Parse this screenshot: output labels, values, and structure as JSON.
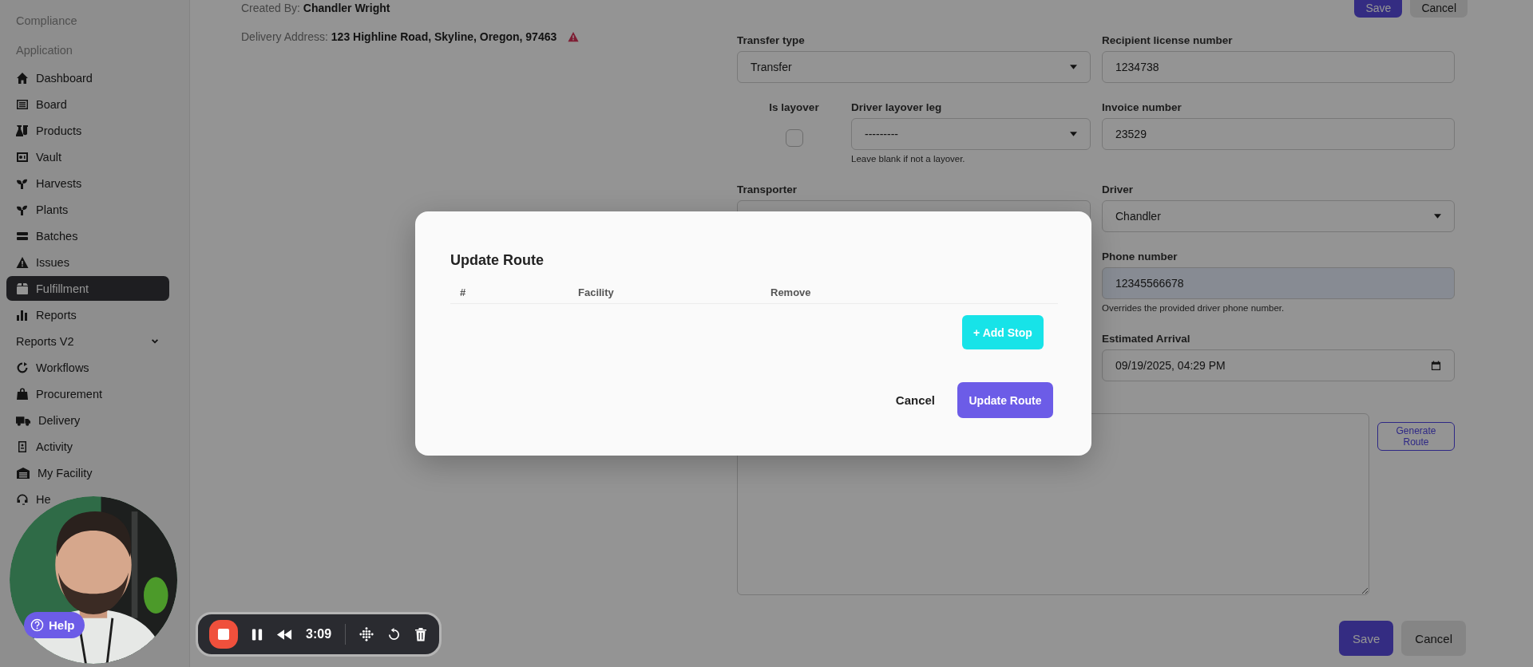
{
  "sidebar": {
    "sections": [
      "Compliance",
      "Application"
    ],
    "items": [
      {
        "label": "Dashboard",
        "kind": "link",
        "selected": false
      },
      {
        "label": "Board",
        "kind": "link",
        "selected": false
      },
      {
        "label": "Products",
        "kind": "link",
        "selected": false
      },
      {
        "label": "Vault",
        "kind": "link",
        "selected": false
      },
      {
        "label": "Harvests",
        "kind": "link",
        "selected": false
      },
      {
        "label": "Plants",
        "kind": "link",
        "selected": false
      },
      {
        "label": "Batches",
        "kind": "link",
        "selected": false
      },
      {
        "label": "Issues",
        "kind": "link",
        "selected": false
      },
      {
        "label": "Fulfillment",
        "kind": "link",
        "selected": true
      },
      {
        "label": "Reports",
        "kind": "link",
        "selected": false
      },
      {
        "label": "Reports V2",
        "kind": "group",
        "expanded": false,
        "selected": false
      },
      {
        "label": "Workflows",
        "kind": "link",
        "selected": false
      },
      {
        "label": "Procurement",
        "kind": "link",
        "selected": false
      },
      {
        "label": "Delivery",
        "kind": "link",
        "selected": false
      },
      {
        "label": "Activity",
        "kind": "link",
        "selected": false
      },
      {
        "label": "My Facility",
        "kind": "link",
        "selected": false
      },
      {
        "label": "He",
        "kind": "link",
        "selected": false
      }
    ]
  },
  "header": {
    "created_by": {
      "label": "Created By:",
      "value": "Chandler Wright"
    },
    "delivery_address": {
      "label": "Delivery Address:",
      "value": "123 Highline Road, Skyline, Oregon, 97463",
      "warning": true
    }
  },
  "top_actions": [
    {
      "label": "Save",
      "kind": "primary"
    },
    {
      "label": "Cancel",
      "kind": "secondary"
    }
  ],
  "form": {
    "transfer_type": {
      "label": "Transfer type",
      "value": "Transfer"
    },
    "recipient_license_number": {
      "label": "Recipient license number",
      "value": "1234738"
    },
    "is_layover": {
      "label": "Is layover",
      "checked": false
    },
    "driver_layover_leg": {
      "label": "Driver layover leg",
      "value": "---------",
      "hint": "Leave blank if not a layover."
    },
    "invoice_number": {
      "label": "Invoice number",
      "value": "23529"
    },
    "transporter": {
      "label": "Transporter"
    },
    "driver": {
      "label": "Driver",
      "value": "Chandler"
    },
    "phone_number": {
      "label": "Phone number",
      "value": "12345566678",
      "hint": "Overrides the provided driver phone number.",
      "autofilled": true
    },
    "estimated_arrival": {
      "label": "Estimated Arrival",
      "value": "09/19/2025, 04:29 PM"
    },
    "generate_route": "Generate Route"
  },
  "footer_actions": [
    {
      "label": "Save",
      "kind": "primary"
    },
    {
      "label": "Cancel",
      "kind": "secondary"
    }
  ],
  "modal": {
    "title": "Update Route",
    "columns": [
      "#",
      "Facility",
      "Remove"
    ],
    "add_stop": "+ Add Stop",
    "cancel": "Cancel",
    "submit": "Update Route"
  },
  "recorder": {
    "time": "3:09"
  },
  "help": "Help"
}
